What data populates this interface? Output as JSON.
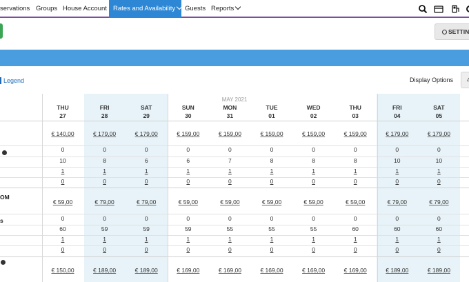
{
  "nav": {
    "items": [
      "servations",
      "Groups",
      "House Account",
      "Rates and Availability",
      "Guests",
      "Reports"
    ],
    "active_index": 3
  },
  "toolbar": {
    "settings_label": "SETTING",
    "display_options": "Display Options",
    "pager_label": "4"
  },
  "legend_label": "Legend",
  "month_label": "MAY 2021",
  "days": [
    {
      "dow": "THU",
      "num": "27"
    },
    {
      "dow": "FRI",
      "num": "28"
    },
    {
      "dow": "SAT",
      "num": "29"
    },
    {
      "dow": "SUN",
      "num": "30"
    },
    {
      "dow": "MON",
      "num": "31"
    },
    {
      "dow": "TUE",
      "num": "01"
    },
    {
      "dow": "WED",
      "num": "02"
    },
    {
      "dow": "THU",
      "num": "03"
    },
    {
      "dow": "FRI",
      "num": "04"
    },
    {
      "dow": "SAT",
      "num": "05"
    }
  ],
  "row_labels": [
    "OM",
    "s"
  ],
  "rows": [
    [
      "€ 140,00",
      "€ 179,00",
      "€ 179,00",
      "€ 159,00",
      "€ 159,00",
      "€ 159,00",
      "€ 159,00",
      "€ 159,00",
      "€ 179,00",
      "€ 179,00"
    ],
    [
      "0",
      "0",
      "0",
      "0",
      "0",
      "0",
      "0",
      "0",
      "0",
      "0"
    ],
    [
      "10",
      "8",
      "6",
      "6",
      "7",
      "8",
      "8",
      "8",
      "10",
      "10"
    ],
    [
      "1",
      "1",
      "1",
      "1",
      "1",
      "1",
      "1",
      "1",
      "1",
      "1"
    ],
    [
      "0",
      "0",
      "0",
      "0",
      "0",
      "0",
      "0",
      "0",
      "0",
      "0"
    ],
    [
      "€ 59,00",
      "€ 79,00",
      "€ 79,00",
      "€ 59,00",
      "€ 59,00",
      "€ 59,00",
      "€ 59,00",
      "€ 59,00",
      "€ 79,00",
      "€ 79,00"
    ],
    [
      "0",
      "0",
      "0",
      "0",
      "0",
      "0",
      "0",
      "0",
      "0",
      "0"
    ],
    [
      "60",
      "59",
      "59",
      "59",
      "55",
      "55",
      "55",
      "60",
      "60",
      "60"
    ],
    [
      "1",
      "1",
      "1",
      "1",
      "1",
      "1",
      "1",
      "1",
      "1",
      "1"
    ],
    [
      "0",
      "0",
      "0",
      "0",
      "0",
      "0",
      "0",
      "0",
      "0",
      "0"
    ],
    [
      "€ 150,00",
      "€ 189,00",
      "€ 189,00",
      "€ 169,00",
      "€ 169,00",
      "€ 169,00",
      "€ 169,00",
      "€ 169,00",
      "€ 189,00",
      "€ 189,00"
    ]
  ],
  "highlight_days": [
    1,
    2,
    8,
    9
  ],
  "colors": {
    "nav_active": "#2d87d4",
    "banner": "#4a9ee0",
    "weekend_highlight": "#e7f3f8",
    "nav_underline": "#7a4fa0",
    "link": "#1f6bb5"
  },
  "icons": [
    "search-icon",
    "card-icon",
    "gas-station-icon",
    "settings-icon"
  ]
}
